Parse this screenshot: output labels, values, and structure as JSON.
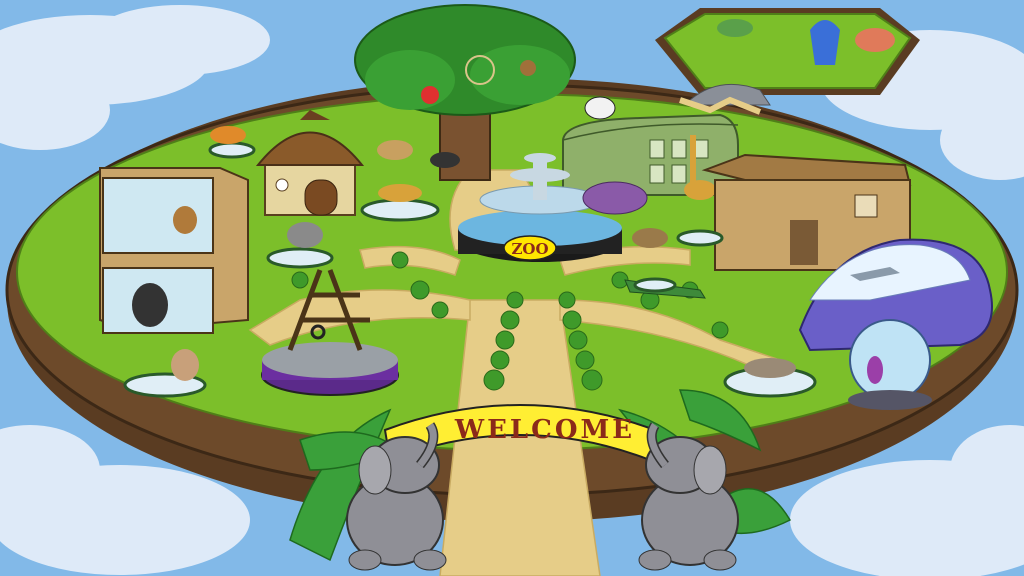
{
  "arch_sign": {
    "label": "WELCOME"
  },
  "fountain_sign": {
    "label": "ZOO"
  },
  "colors": {
    "sky": "#7fb7e6",
    "cloud": "#e9f1fb",
    "grass": "#7cbf2a",
    "dirt_rim": "#6b4a2b",
    "path": "#e8cf8a",
    "sign_yellow": "#ffee33",
    "sign_text": "#8b2a1a",
    "elephant": "#8f8f96"
  },
  "attractions": [
    {
      "name": "tree-house-aviary",
      "icon": "tree-icon"
    },
    {
      "name": "dinosaur-island",
      "icon": "dinosaur-icon"
    },
    {
      "name": "reptile-house",
      "icon": "greenhouse-icon"
    },
    {
      "name": "fountain",
      "icon": "fountain-icon"
    },
    {
      "name": "primate-house",
      "icon": "building-icon"
    },
    {
      "name": "hut",
      "icon": "hut-icon"
    },
    {
      "name": "barn",
      "icon": "barn-icon"
    },
    {
      "name": "aquarium",
      "icon": "wave-icon"
    },
    {
      "name": "playground",
      "icon": "climbing-frame-icon"
    }
  ]
}
